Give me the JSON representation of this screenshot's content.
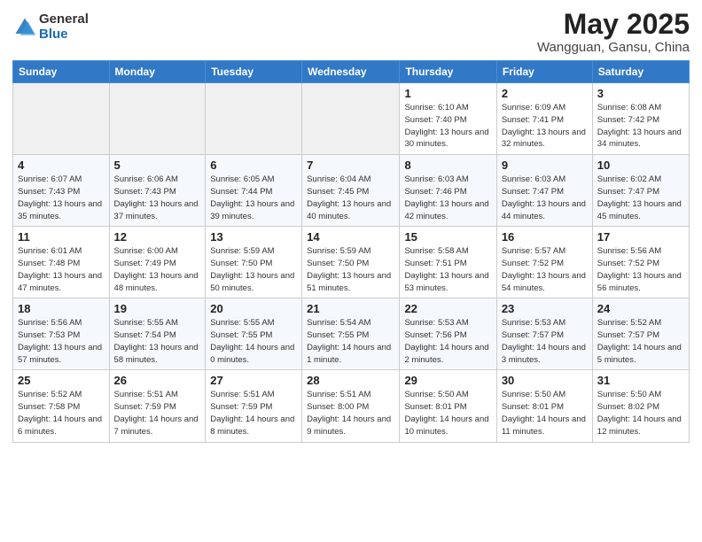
{
  "logo": {
    "general": "General",
    "blue": "Blue"
  },
  "title": "May 2025",
  "subtitle": "Wangguan, Gansu, China",
  "days_of_week": [
    "Sunday",
    "Monday",
    "Tuesday",
    "Wednesday",
    "Thursday",
    "Friday",
    "Saturday"
  ],
  "weeks": [
    [
      {
        "num": "",
        "detail": ""
      },
      {
        "num": "",
        "detail": ""
      },
      {
        "num": "",
        "detail": ""
      },
      {
        "num": "",
        "detail": ""
      },
      {
        "num": "1",
        "detail": "Sunrise: 6:10 AM\nSunset: 7:40 PM\nDaylight: 13 hours\nand 30 minutes."
      },
      {
        "num": "2",
        "detail": "Sunrise: 6:09 AM\nSunset: 7:41 PM\nDaylight: 13 hours\nand 32 minutes."
      },
      {
        "num": "3",
        "detail": "Sunrise: 6:08 AM\nSunset: 7:42 PM\nDaylight: 13 hours\nand 34 minutes."
      }
    ],
    [
      {
        "num": "4",
        "detail": "Sunrise: 6:07 AM\nSunset: 7:43 PM\nDaylight: 13 hours\nand 35 minutes."
      },
      {
        "num": "5",
        "detail": "Sunrise: 6:06 AM\nSunset: 7:43 PM\nDaylight: 13 hours\nand 37 minutes."
      },
      {
        "num": "6",
        "detail": "Sunrise: 6:05 AM\nSunset: 7:44 PM\nDaylight: 13 hours\nand 39 minutes."
      },
      {
        "num": "7",
        "detail": "Sunrise: 6:04 AM\nSunset: 7:45 PM\nDaylight: 13 hours\nand 40 minutes."
      },
      {
        "num": "8",
        "detail": "Sunrise: 6:03 AM\nSunset: 7:46 PM\nDaylight: 13 hours\nand 42 minutes."
      },
      {
        "num": "9",
        "detail": "Sunrise: 6:03 AM\nSunset: 7:47 PM\nDaylight: 13 hours\nand 44 minutes."
      },
      {
        "num": "10",
        "detail": "Sunrise: 6:02 AM\nSunset: 7:47 PM\nDaylight: 13 hours\nand 45 minutes."
      }
    ],
    [
      {
        "num": "11",
        "detail": "Sunrise: 6:01 AM\nSunset: 7:48 PM\nDaylight: 13 hours\nand 47 minutes."
      },
      {
        "num": "12",
        "detail": "Sunrise: 6:00 AM\nSunset: 7:49 PM\nDaylight: 13 hours\nand 48 minutes."
      },
      {
        "num": "13",
        "detail": "Sunrise: 5:59 AM\nSunset: 7:50 PM\nDaylight: 13 hours\nand 50 minutes."
      },
      {
        "num": "14",
        "detail": "Sunrise: 5:59 AM\nSunset: 7:50 PM\nDaylight: 13 hours\nand 51 minutes."
      },
      {
        "num": "15",
        "detail": "Sunrise: 5:58 AM\nSunset: 7:51 PM\nDaylight: 13 hours\nand 53 minutes."
      },
      {
        "num": "16",
        "detail": "Sunrise: 5:57 AM\nSunset: 7:52 PM\nDaylight: 13 hours\nand 54 minutes."
      },
      {
        "num": "17",
        "detail": "Sunrise: 5:56 AM\nSunset: 7:52 PM\nDaylight: 13 hours\nand 56 minutes."
      }
    ],
    [
      {
        "num": "18",
        "detail": "Sunrise: 5:56 AM\nSunset: 7:53 PM\nDaylight: 13 hours\nand 57 minutes."
      },
      {
        "num": "19",
        "detail": "Sunrise: 5:55 AM\nSunset: 7:54 PM\nDaylight: 13 hours\nand 58 minutes."
      },
      {
        "num": "20",
        "detail": "Sunrise: 5:55 AM\nSunset: 7:55 PM\nDaylight: 14 hours\nand 0 minutes."
      },
      {
        "num": "21",
        "detail": "Sunrise: 5:54 AM\nSunset: 7:55 PM\nDaylight: 14 hours\nand 1 minute."
      },
      {
        "num": "22",
        "detail": "Sunrise: 5:53 AM\nSunset: 7:56 PM\nDaylight: 14 hours\nand 2 minutes."
      },
      {
        "num": "23",
        "detail": "Sunrise: 5:53 AM\nSunset: 7:57 PM\nDaylight: 14 hours\nand 3 minutes."
      },
      {
        "num": "24",
        "detail": "Sunrise: 5:52 AM\nSunset: 7:57 PM\nDaylight: 14 hours\nand 5 minutes."
      }
    ],
    [
      {
        "num": "25",
        "detail": "Sunrise: 5:52 AM\nSunset: 7:58 PM\nDaylight: 14 hours\nand 6 minutes."
      },
      {
        "num": "26",
        "detail": "Sunrise: 5:51 AM\nSunset: 7:59 PM\nDaylight: 14 hours\nand 7 minutes."
      },
      {
        "num": "27",
        "detail": "Sunrise: 5:51 AM\nSunset: 7:59 PM\nDaylight: 14 hours\nand 8 minutes."
      },
      {
        "num": "28",
        "detail": "Sunrise: 5:51 AM\nSunset: 8:00 PM\nDaylight: 14 hours\nand 9 minutes."
      },
      {
        "num": "29",
        "detail": "Sunrise: 5:50 AM\nSunset: 8:01 PM\nDaylight: 14 hours\nand 10 minutes."
      },
      {
        "num": "30",
        "detail": "Sunrise: 5:50 AM\nSunset: 8:01 PM\nDaylight: 14 hours\nand 11 minutes."
      },
      {
        "num": "31",
        "detail": "Sunrise: 5:50 AM\nSunset: 8:02 PM\nDaylight: 14 hours\nand 12 minutes."
      }
    ]
  ]
}
